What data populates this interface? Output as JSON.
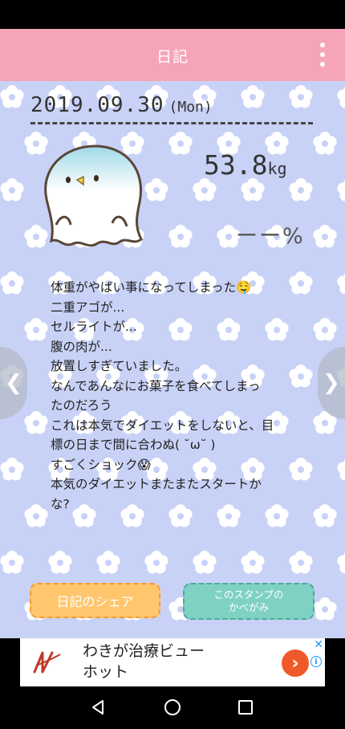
{
  "header": {
    "title": "日記"
  },
  "entry": {
    "date": "2019.09.30",
    "day_of_week": "(Mon)",
    "weight_value": "53.8",
    "weight_unit": "kg",
    "body_fat": "ーー%",
    "text": "体重がやばい事になってしまった🤤\n二重アゴが...\nセルライトが...\n腹の肉が...\n放置しすぎていました。\nなんであんなにお菓子を食べてしまっ\nたのだろう\nこれは本気でダイエットをしないと、目\n標の日まで間に合わぬ( ˘ω˘ )\nすごくショック😱\n本気のダイエットまたまたスタートか\nな?"
  },
  "buttons": {
    "share": "日記のシェア",
    "stamp_line1": "このスタンプの",
    "stamp_line2": "かべがみ"
  },
  "ad": {
    "line1": "わきが治療ビュー",
    "line2": "ホット",
    "close": "✕",
    "info": "i"
  },
  "icons": {
    "menu": "more-vert-icon",
    "prev": "chevron-left-icon",
    "next": "chevron-right-icon",
    "back": "triangle-back-icon",
    "home": "circle-home-icon",
    "recents": "square-recents-icon"
  },
  "colors": {
    "header": "#f6a5b8",
    "background": "#c8d2f6",
    "share_button": "#ffc66e",
    "stamp_button": "#7fd1c4"
  }
}
